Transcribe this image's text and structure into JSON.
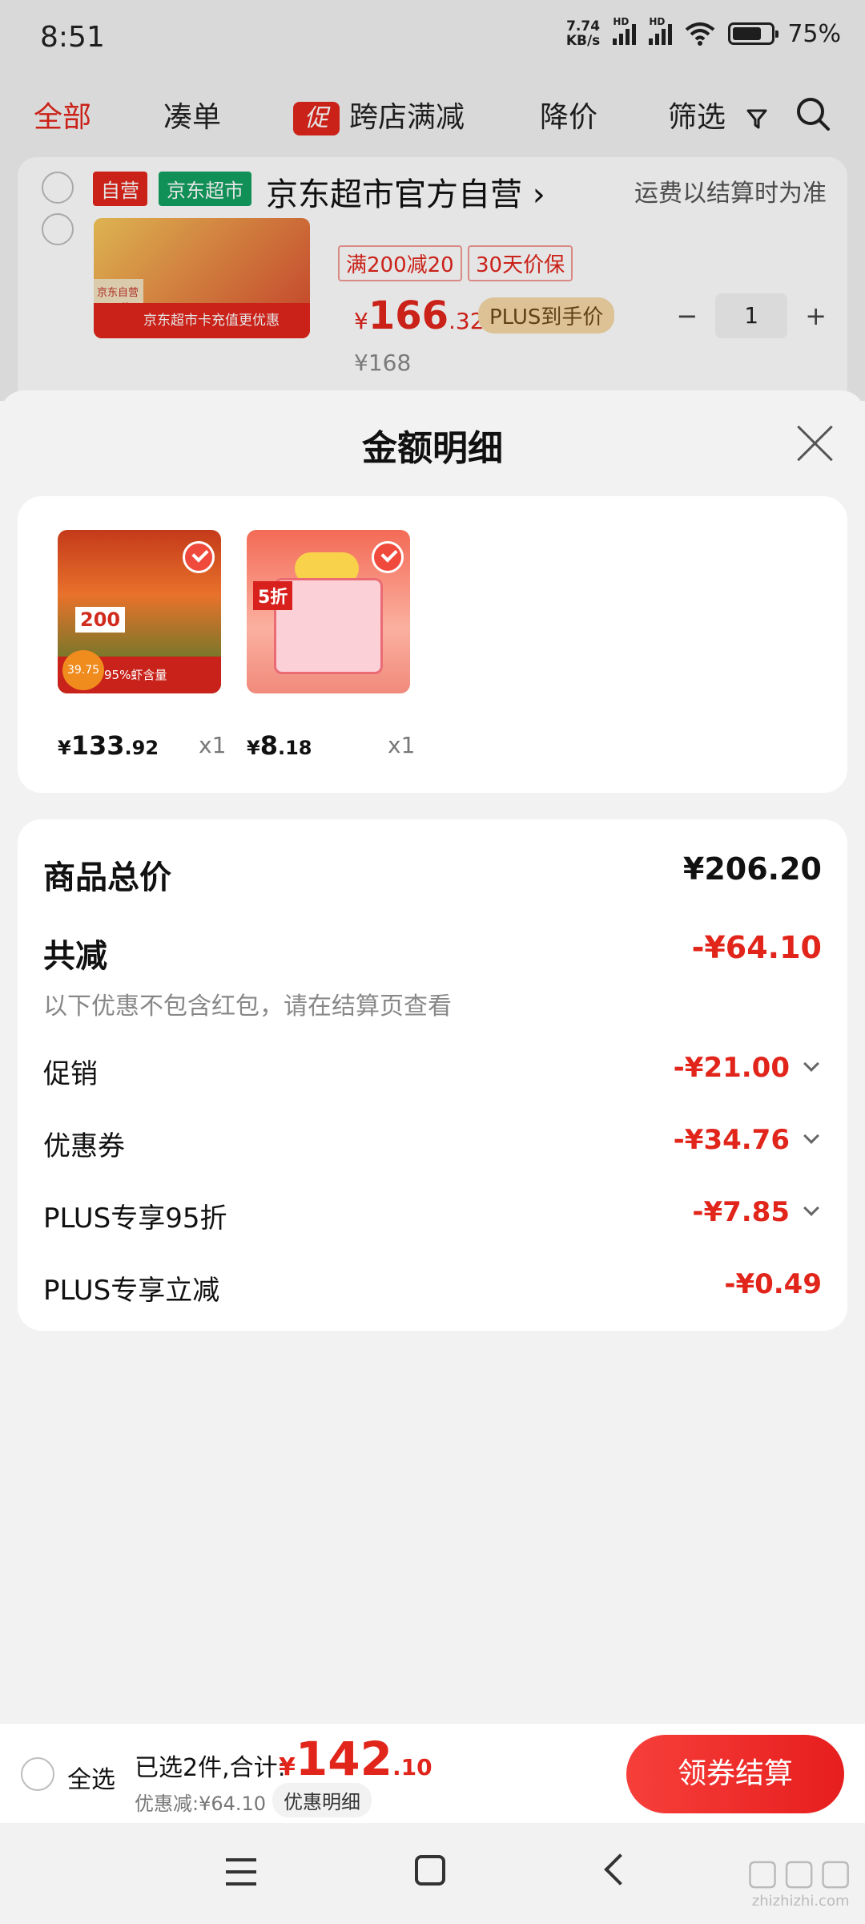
{
  "status_bar": {
    "time": "8:51",
    "net_speed_value": "7.74",
    "net_speed_unit": "KB/s",
    "signal_label": "HD",
    "battery": "75%",
    "battery_level": 0.75
  },
  "filters": {
    "all": "全部",
    "bundle": "凑单",
    "promo_icon": "促",
    "cross_store": "跨店满减",
    "price_drop": "降价",
    "filter": "筛选"
  },
  "store": {
    "self_tag": "自营",
    "supermarket_tag": "京东超市",
    "name": "京东超市官方自营",
    "shipping_note": "运费以结算时为准",
    "product": {
      "promo_tag": "满200减20",
      "guarantee_tag": "30天价保",
      "price_currency": "¥",
      "price_int": "166",
      "price_dec": ".32",
      "plus_label": "PLUS到手价",
      "qty": "1",
      "original_price": "¥168",
      "img_banner": "京东超市卡充值更优惠",
      "img_corner": "京东自营 30天价保"
    }
  },
  "sheet": {
    "title": "金额明细",
    "items": [
      {
        "currency": "¥",
        "int": "133",
        "dec": ".92",
        "qty": "x1",
        "img_badge": "200",
        "img_strip": "95%虾含量",
        "img_price": "39.75"
      },
      {
        "currency": "¥",
        "int": "8",
        "dec": ".18",
        "qty": "x1",
        "img_badge": "5折"
      }
    ],
    "summary": {
      "total_label": "商品总价",
      "total_value": "¥206.20",
      "reduce_label": "共减",
      "reduce_value": "-¥64.10",
      "reduce_note": "以下优惠不包含红包，请在结算页查看",
      "lines": [
        {
          "label": "促销",
          "value": "-¥21.00"
        },
        {
          "label": "优惠券",
          "value": "-¥34.76"
        },
        {
          "label": "PLUS专享95折",
          "value": "-¥7.85"
        },
        {
          "label": "PLUS专享立减",
          "value": "-¥0.49"
        }
      ]
    }
  },
  "bottom_bar": {
    "select_all": "全选",
    "selected_summary": "已选2件,合计:",
    "total_currency": "¥",
    "total_int": "142",
    "total_dec": ".10",
    "discount": "优惠减:¥64.10",
    "detail_button": "优惠明细",
    "checkout_button": "领券结算"
  },
  "watermark": {
    "text": "zhizhizhi.com"
  },
  "colors": {
    "accent": "#e1251b",
    "background": "#f2f2f2"
  }
}
